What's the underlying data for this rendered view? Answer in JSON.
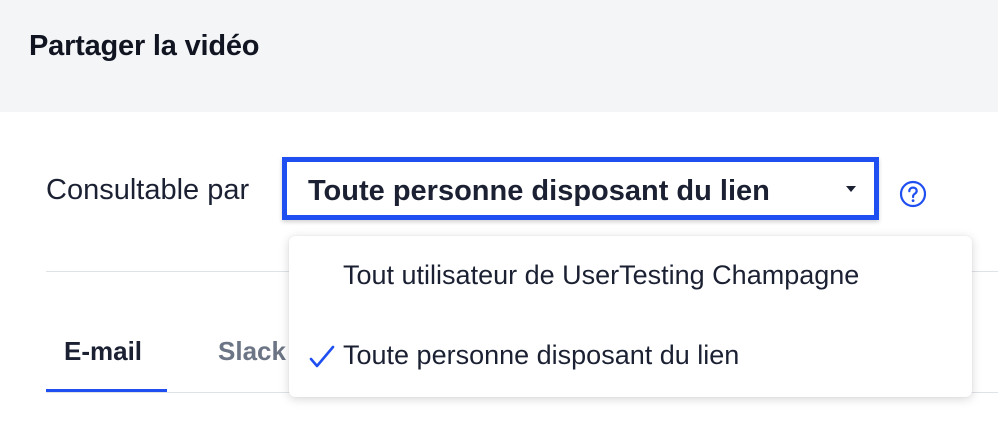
{
  "header": {
    "title": "Partager la vidéo"
  },
  "visibility": {
    "label": "Consultable par",
    "selected_value": "Toute personne disposant du lien",
    "options": [
      {
        "label": "Tout utilisateur de UserTesting Champagne",
        "checked": false
      },
      {
        "label": "Toute personne disposant du lien",
        "checked": true
      }
    ],
    "help_icon": "question-circle-icon"
  },
  "tabs": [
    {
      "label": "E-mail",
      "active": true
    },
    {
      "label": "Slack",
      "active": false
    }
  ],
  "colors": {
    "accent": "#1f4ff0",
    "header_bg": "#f4f5f7",
    "text_primary": "#1b2133",
    "text_muted": "#6c7585",
    "divider": "#dfe2e7"
  }
}
